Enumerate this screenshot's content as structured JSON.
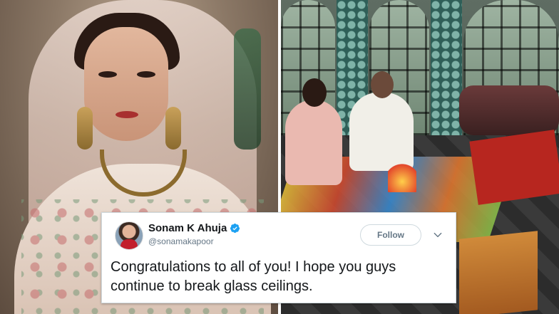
{
  "tweet": {
    "display_name": "Sonam K Ahuja",
    "handle": "@sonamakapoor",
    "follow_label": "Follow",
    "text": "Congratulations to all of you! I hope you guys continue to break glass ceilings.",
    "verified": true
  },
  "colors": {
    "verified_badge": "#1da1f2",
    "card_background": "#ffffff",
    "text_primary": "#14171a",
    "text_secondary": "#657786"
  },
  "icons": {
    "verified": "verified-badge-icon",
    "chevron": "chevron-down-icon"
  }
}
